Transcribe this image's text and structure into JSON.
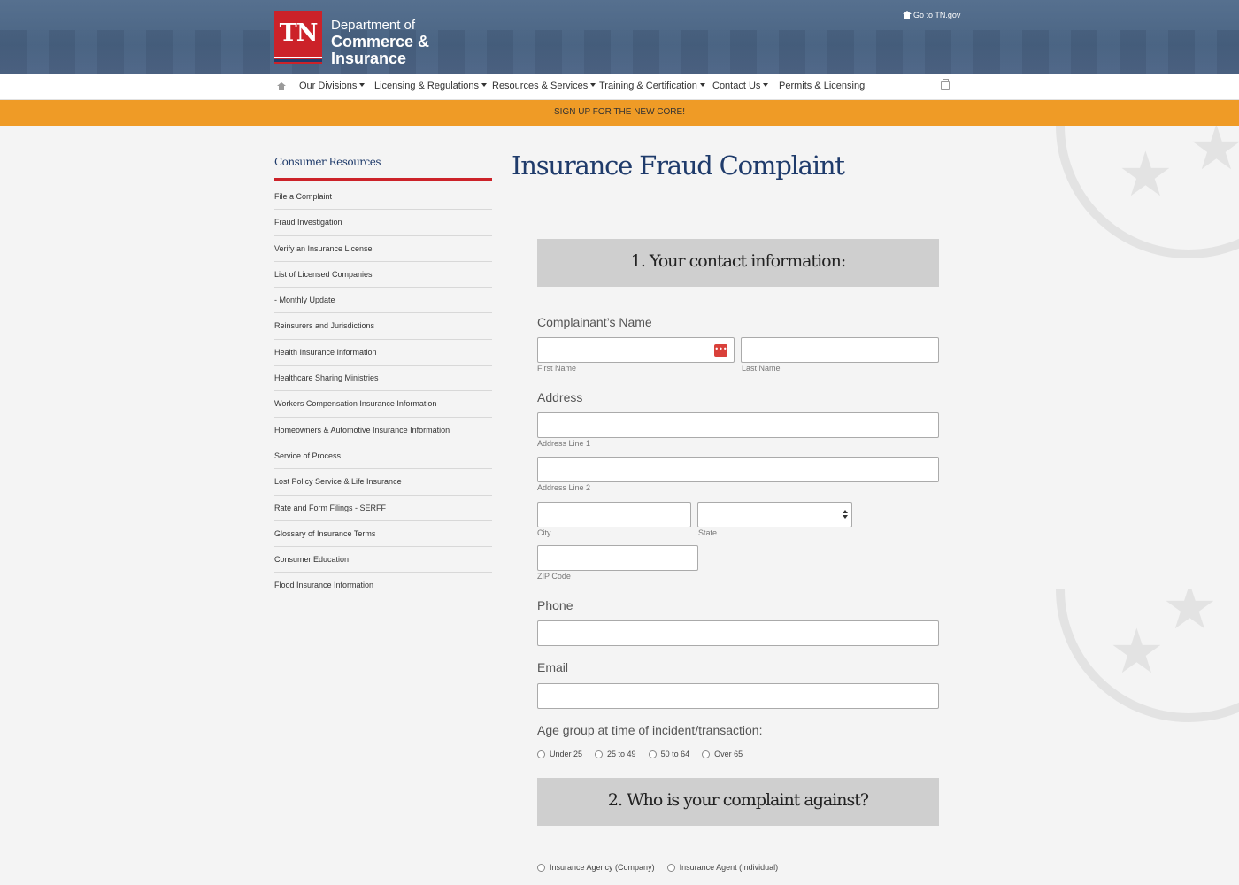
{
  "header": {
    "logo_abbr": "TN",
    "logo_line1": "Department of",
    "logo_line2": "Commerce &",
    "logo_line3": "Insurance",
    "goto_link": "Go to TN.gov"
  },
  "nav": {
    "items": [
      "Our Divisions",
      "Licensing & Regulations",
      "Resources & Services",
      "Training & Certification",
      "Contact Us",
      "Permits & Licensing"
    ]
  },
  "banner": {
    "text": "SIGN UP FOR THE NEW CORE!"
  },
  "sidebar": {
    "title": "Consumer Resources",
    "items": [
      "File a Complaint",
      "Fraud Investigation",
      "Verify an Insurance License",
      "List of Licensed Companies",
      "- Monthly Update",
      "Reinsurers and Jurisdictions",
      "Health Insurance Information",
      "Healthcare Sharing Ministries",
      "Workers Compensation Insurance Information",
      "Homeowners & Automotive Insurance Information",
      "Service of Process",
      "Lost Policy Service & Life Insurance",
      "Rate and Form Filings - SERFF",
      "Glossary of Insurance Terms",
      "Consumer Education",
      "Flood Insurance Information"
    ]
  },
  "main": {
    "title": "Insurance Fraud Complaint",
    "section1": "1. Your contact information:",
    "name_label": "Complainant’s Name",
    "first_name": "First Name",
    "last_name": "Last Name",
    "address_label": "Address",
    "address_line1": "Address Line 1",
    "address_line2": "Address Line 2",
    "city": "City",
    "state": "State",
    "zip": "ZIP Code",
    "phone_label": "Phone",
    "email_label": "Email",
    "age_label": "Age group at time of incident/transaction:",
    "age_options": [
      "Under 25",
      "25 to 49",
      "50 to 64",
      "Over 65"
    ],
    "section2": "2. Who is your complaint against?",
    "against_options": [
      "Insurance Agency (Company)",
      "Insurance Agent (Individual)"
    ]
  },
  "colors": {
    "brand_red": "#cc2229",
    "banner_orange": "#ef9b26",
    "heading_blue": "#1f3b6b"
  }
}
